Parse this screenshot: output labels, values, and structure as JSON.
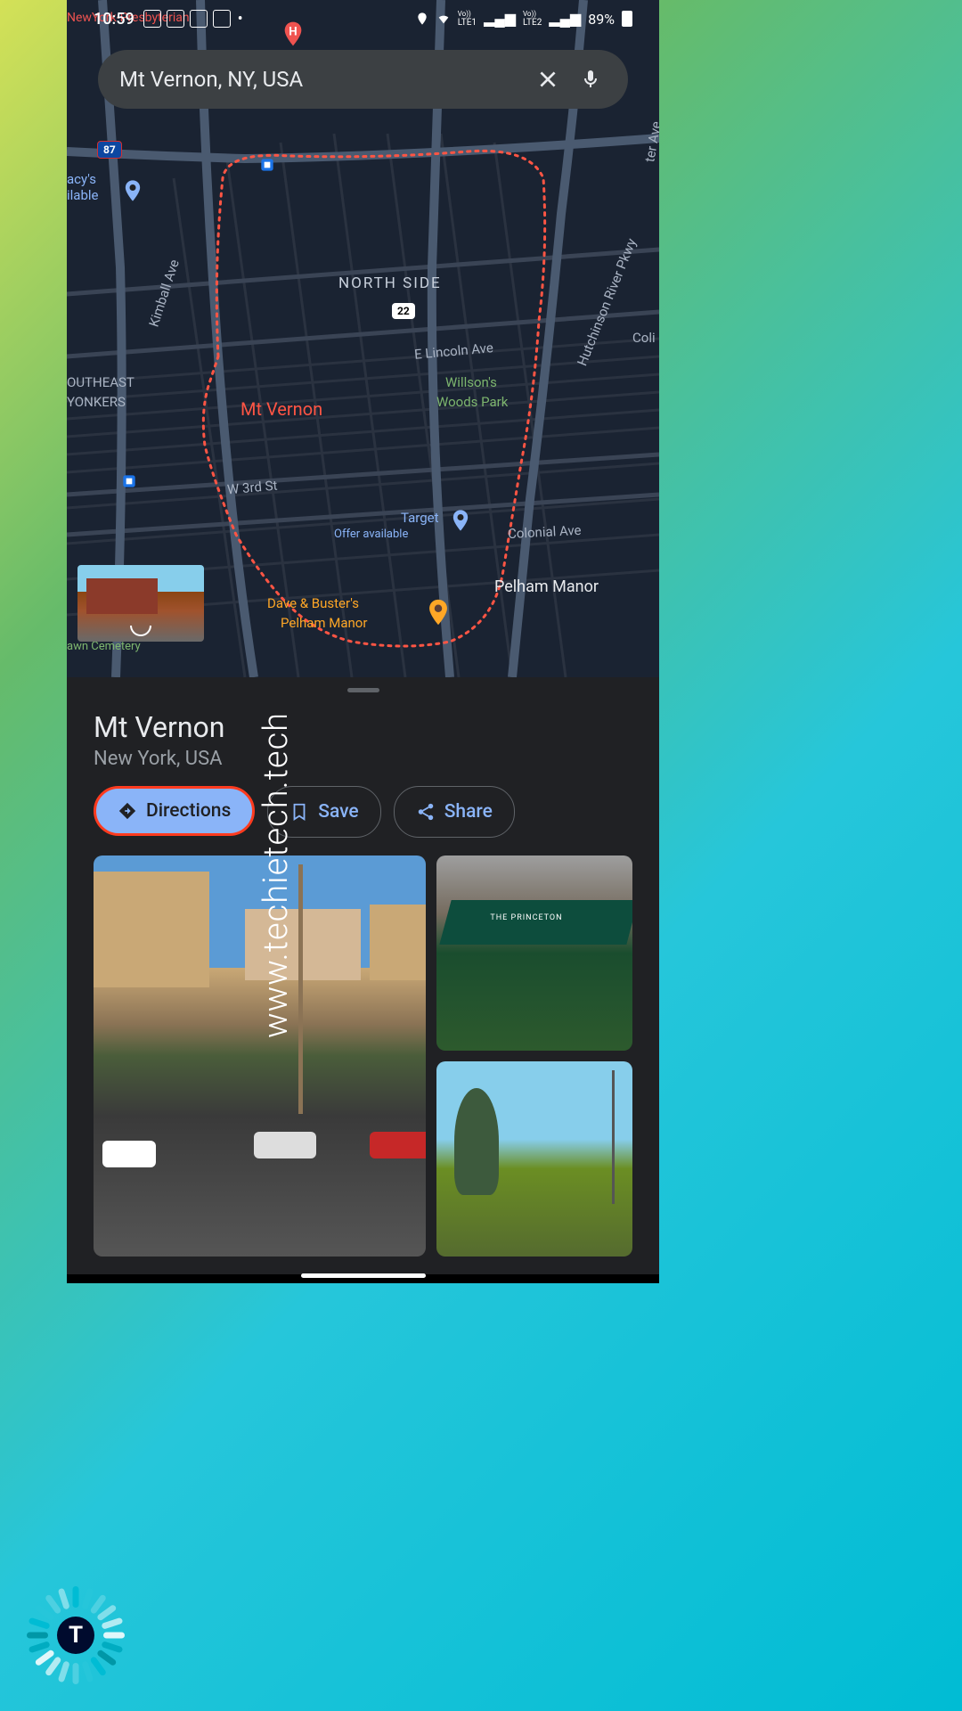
{
  "status_bar": {
    "time": "10:59",
    "battery_percent": "89%",
    "carrier1": "LTE1",
    "carrier2": "LTE2"
  },
  "search": {
    "query": "Mt Vernon, NY, USA"
  },
  "map": {
    "city_label": "Mt Vernon",
    "district_north": "NORTH SIDE",
    "area_yonkers_1": "OUTHEAST",
    "area_yonkers_2": "YONKERS",
    "pelham_manor": "Pelham Manor",
    "route_87": "87",
    "route_22": "22",
    "roads": {
      "kimball": "Kimball Ave",
      "hutchinson": "Hutchinson River Pkwy",
      "lincoln": "E Lincoln Ave",
      "w3rd": "W 3rd St",
      "colonial": "Colonial Ave",
      "ter_ave": "ter Ave",
      "coli": "Coli"
    },
    "park": {
      "willsons_1": "Willson's",
      "willsons_2": "Woods Park"
    },
    "poi": {
      "target": "Target",
      "target_offer": "Offer available",
      "cemetery": "awn Cemetery",
      "macys_1": "acy's",
      "macys_2": "ilable",
      "dave_1": "Dave & Buster's",
      "dave_2": "Pelham Manor",
      "nyp": "NewYork-Presbyterian"
    },
    "photo_building": "THE PRINCETON"
  },
  "place": {
    "title": "Mt Vernon",
    "subtitle": "New York, USA"
  },
  "actions": {
    "directions": "Directions",
    "save": "Save",
    "share": "Share"
  },
  "watermark": "www.techietech.tech",
  "logo_letter": "T"
}
